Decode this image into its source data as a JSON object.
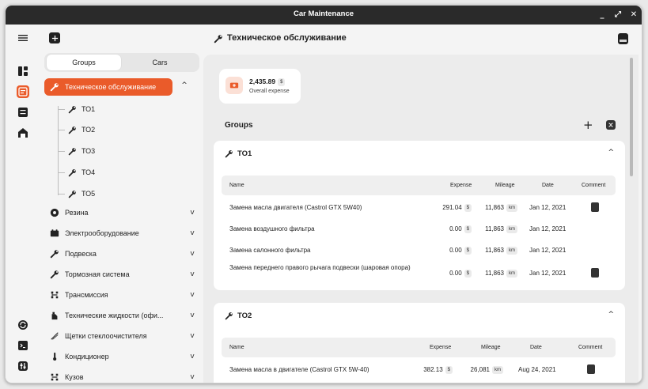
{
  "window": {
    "title": "Car Maintenance",
    "controls": [
      "_",
      "⤢",
      "✕"
    ]
  },
  "page": {
    "title": "Техническое обслуживание"
  },
  "tabs": {
    "groups": "Groups",
    "cars": "Cars"
  },
  "sidebar": {
    "active": {
      "label": "Техническое обслуживание",
      "chevron": "^"
    },
    "children": [
      "ТО1",
      "ТО2",
      "ТО3",
      "ТО4",
      "ТО5"
    ],
    "items": [
      {
        "label": "Резина",
        "icon": "tire-icon",
        "chevron": "v"
      },
      {
        "label": "Электрооборудование",
        "icon": "battery-icon",
        "chevron": "v"
      },
      {
        "label": "Подвеска",
        "icon": "wrench-icon",
        "chevron": "v"
      },
      {
        "label": "Тормозная система",
        "icon": "wrench-icon",
        "chevron": "v"
      },
      {
        "label": "Трансмиссия",
        "icon": "gearbox-icon",
        "chevron": "v"
      },
      {
        "label": "Технические жидкости (офи...",
        "icon": "oil-icon",
        "chevron": "v"
      },
      {
        "label": "Щетки стеклоочистителя",
        "icon": "wiper-icon",
        "chevron": "v"
      },
      {
        "label": "Кондиционер",
        "icon": "thermometer-icon",
        "chevron": "v"
      },
      {
        "label": "Кузов",
        "icon": "gearbox-icon",
        "chevron": "v"
      }
    ]
  },
  "summary": {
    "amount": "2,435.89",
    "currency": "$",
    "label": "Overall expense"
  },
  "groups_heading": "Groups",
  "groups_add": "+",
  "columns": {
    "name": "Name",
    "expense": "Expense",
    "mileage": "Mileage",
    "date": "Date",
    "comment": "Comment"
  },
  "cards": [
    {
      "title": "ТО1",
      "chevron": "^",
      "rows": [
        {
          "name": "Замена масла двигателя (Castrol GTX 5W40)",
          "expense": "291.04",
          "currency": "$",
          "mileage": "11,863",
          "unit": "km",
          "date": "Jan 12, 2021",
          "comment": true
        },
        {
          "name": "Замена воздушного фильтра",
          "expense": "0.00",
          "currency": "$",
          "mileage": "11,863",
          "unit": "km",
          "date": "Jan 12, 2021",
          "comment": false
        },
        {
          "name": "Замена салонного фильтра",
          "expense": "0.00",
          "currency": "$",
          "mileage": "11,863",
          "unit": "km",
          "date": "Jan 12, 2021",
          "comment": false
        },
        {
          "name": "Замена переднего правого рычага подвески (шаровая опора)",
          "expense": "0.00",
          "currency": "$",
          "mileage": "11,863",
          "unit": "km",
          "date": "Jan 12, 2021",
          "comment": true
        }
      ]
    },
    {
      "title": "ТО2",
      "chevron": "^",
      "rows": [
        {
          "name": "Замена масла в двигателе (Castrol GTX 5W-40)",
          "expense": "382.13",
          "currency": "$",
          "mileage": "26,081",
          "unit": "km",
          "date": "Aug 24, 2021",
          "comment": true
        }
      ]
    }
  ],
  "colors": {
    "accent": "#ea5b2a",
    "titlebar": "#2a2a2a"
  }
}
